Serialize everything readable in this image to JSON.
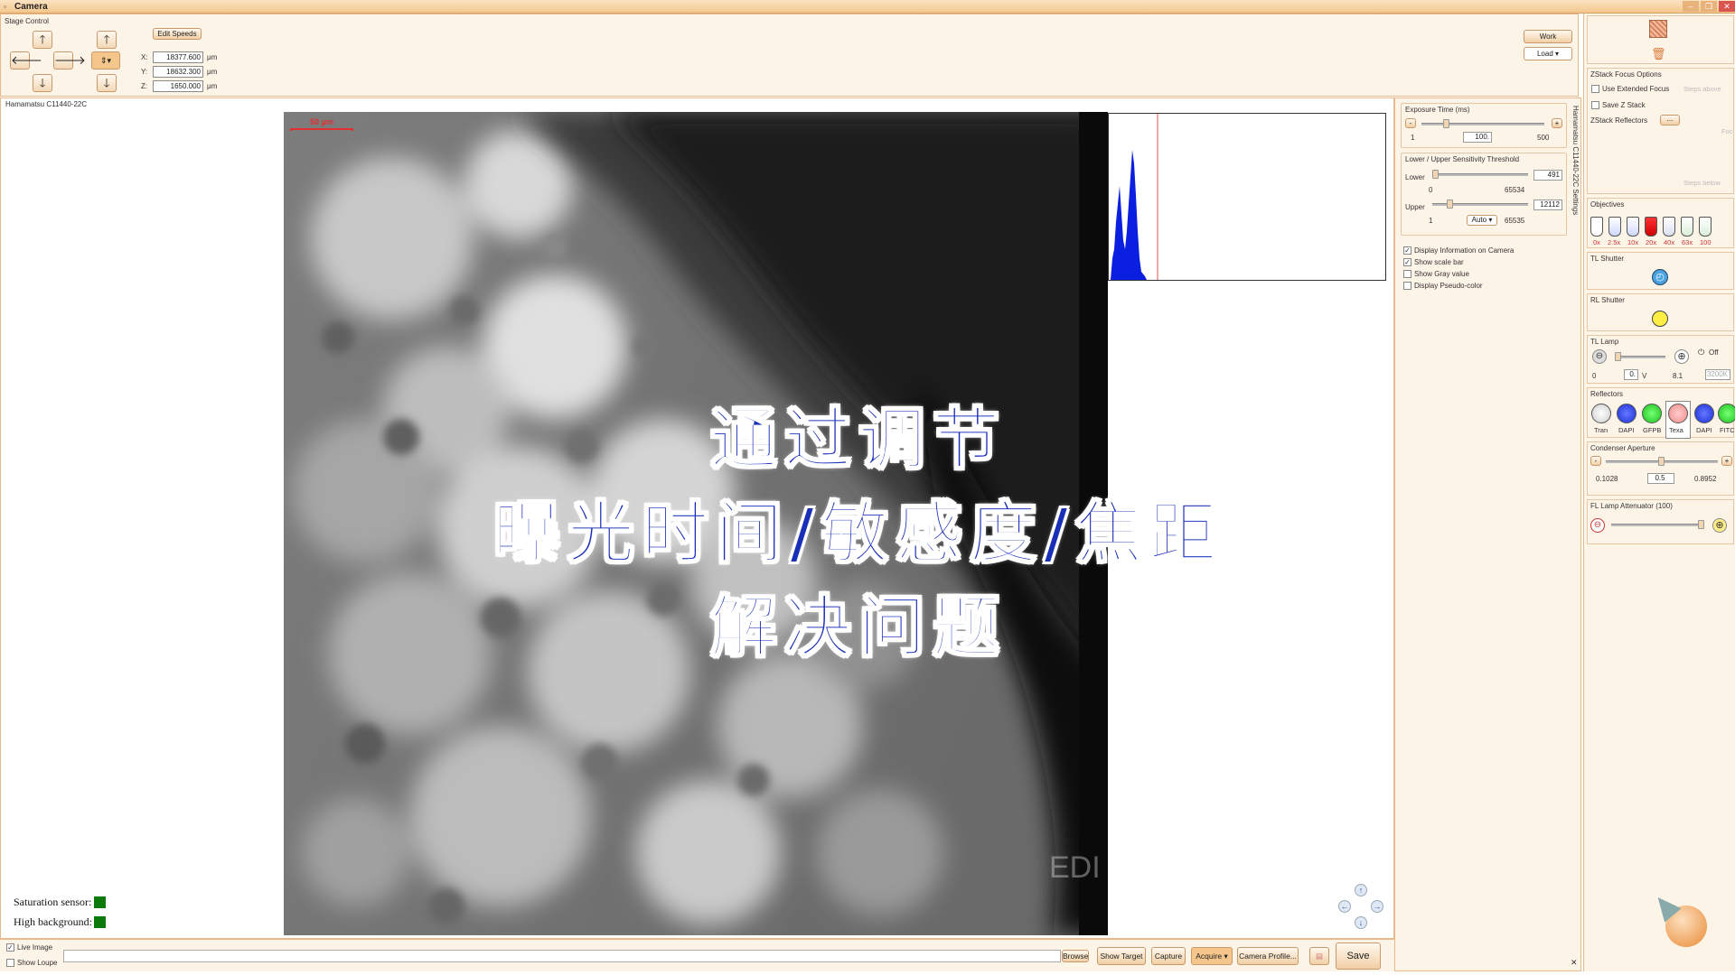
{
  "window": {
    "title": "Camera",
    "minimize": "–",
    "restore": "❐",
    "close": "✕"
  },
  "stage": {
    "title": "Stage Control",
    "edit_speeds": "Edit Speeds",
    "x_label": "X:",
    "x_value": "18377.600",
    "y_label": "Y:",
    "y_value": "18632.300",
    "z_label": "Z:",
    "z_value": "1650.000",
    "unit": "μm",
    "work_button": "Work",
    "load_select": "Load"
  },
  "camera": {
    "name": "Hamamatsu C11440-22C",
    "scale_bar": "50 μm",
    "watermark": "EDI",
    "saturation_label": "Saturation sensor:",
    "background_label": "High background:",
    "status_color": "#0a7a0a"
  },
  "bottom": {
    "live_image": "Live Image",
    "show_loupe": "Show Loupe",
    "browse": "Browse",
    "show_target": "Show Target",
    "capture": "Capture",
    "acquire": "Acquire",
    "camera_profile": "Camera Profile...",
    "save": "Save"
  },
  "settings": {
    "vertical_title": "Hamamatsu C11440-22C Settings",
    "exposure_title": "Exposure Time (ms)",
    "exposure_min": "1",
    "exposure_value": "100.",
    "exposure_max": "500",
    "exposure_minus": "-",
    "exposure_plus": "+",
    "threshold_title": "Lower / Upper Sensitivity Threshold",
    "lower_label": "Lower",
    "lower_value": "491",
    "lower_min": "0",
    "lower_max": "65534",
    "upper_label": "Upper",
    "upper_value": "12112",
    "upper_min": "1",
    "upper_max": "65535",
    "auto_select": "Auto",
    "options": [
      {
        "label": "Display Information on Camera",
        "checked": "✓"
      },
      {
        "label": "Show scale bar",
        "checked": "✓"
      },
      {
        "label": "Show Gray value",
        "checked": ""
      },
      {
        "label": "Display Pseudo-color",
        "checked": ""
      }
    ]
  },
  "right": {
    "zstack_title": "ZStack Focus Options",
    "use_extended_focus": "Use Extended Focus",
    "save_z_stack": "Save Z Stack",
    "zstack_reflectors": "ZStack Reflectors",
    "reflectors_btn": "...",
    "steps_above": "Steps above",
    "steps_below": "Steps below",
    "foc": "Foc",
    "objectives_title": "Objectives",
    "objectives": [
      "0x",
      "2.5x",
      "10x",
      "20x",
      "40x",
      "63x",
      "100"
    ],
    "tl_shutter": "TL Shutter",
    "rl_shutter": "RL Shutter",
    "tl_lamp": "TL Lamp",
    "tl_lamp_off": "Off",
    "tl_lamp_min": "0",
    "tl_lamp_value": "0.",
    "tl_lamp_unit": "V",
    "tl_lamp_max": "8.1",
    "tl_lamp_temp": "3200K",
    "reflectors_title": "Reflectors",
    "reflectors": [
      {
        "label": "Tran",
        "color": "#f4f4f4"
      },
      {
        "label": "DAPI",
        "color": "#1a2fd8"
      },
      {
        "label": "GFPB",
        "color": "#19c219"
      },
      {
        "label": "Texa",
        "color": "#f08a8a"
      },
      {
        "label": "DAPI",
        "color": "#1a2fd8"
      },
      {
        "label": "FITC",
        "color": "#19c219"
      }
    ],
    "condenser_title": "Condenser Aperture",
    "condenser_min": "0.1028",
    "condenser_value": "0.5",
    "condenser_max": "0.8952",
    "fl_lamp_title": "FL Lamp Attenuator (100)"
  },
  "overlay": {
    "line1": "通过调节",
    "line2": "曝光时间/敏感度/焦距",
    "line3": "解决问题"
  }
}
